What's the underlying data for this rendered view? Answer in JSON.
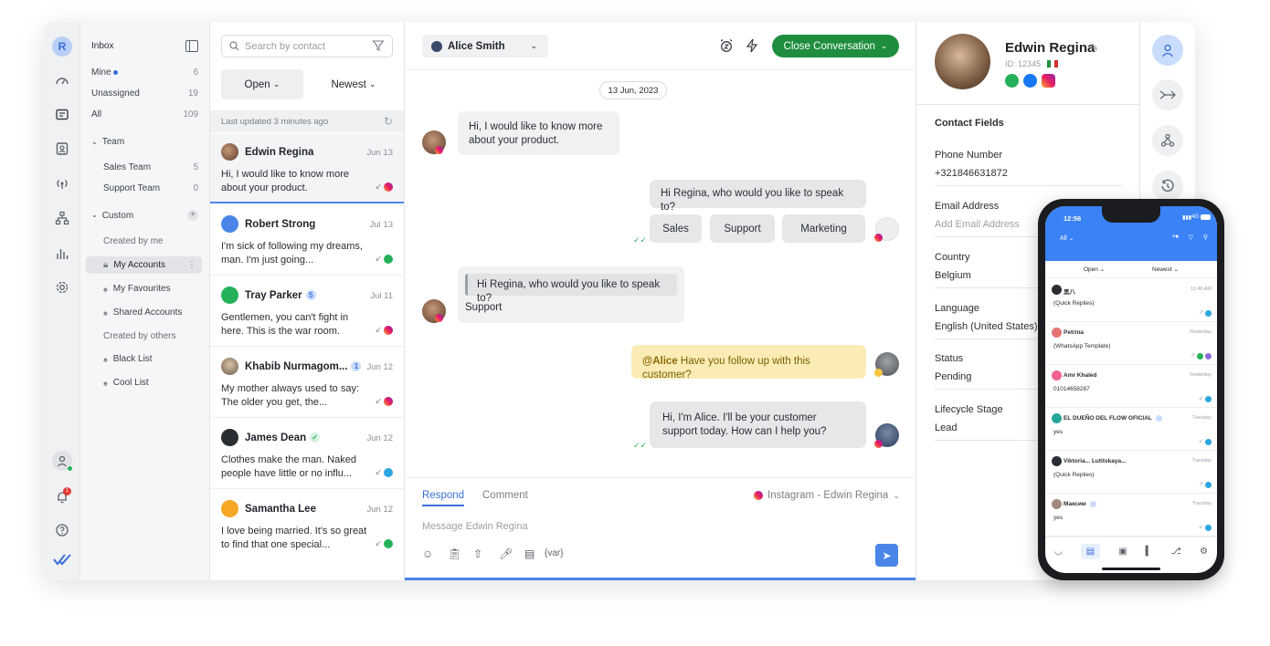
{
  "rail": {
    "avatar_letter": "R",
    "icons": [
      "dashboard-icon",
      "messages-icon",
      "contacts-icon",
      "broadcast-icon",
      "workflows-icon",
      "reports-icon",
      "settings-icon"
    ],
    "bottom_icons": [
      "user-status-icon",
      "notifications-icon",
      "help-icon",
      "logo-icon"
    ],
    "notification_count": "1"
  },
  "inbox": {
    "title": "Inbox",
    "items": [
      {
        "label": "Mine",
        "count": "6"
      },
      {
        "label": "Unassigned",
        "count": "19"
      },
      {
        "label": "All",
        "count": "109"
      }
    ],
    "team_header": "Team",
    "teams": [
      {
        "label": "Sales Team",
        "count": "5"
      },
      {
        "label": "Support Team",
        "count": "0"
      }
    ],
    "custom_header": "Custom",
    "created_by_me": "Created by me",
    "my_lists": [
      "My Accounts",
      "My Favourites",
      "Shared Accounts"
    ],
    "created_by_others": "Created by others",
    "other_lists": [
      "Black List",
      "Cool List"
    ]
  },
  "conversations": {
    "search_placeholder": "Search by contact",
    "status_filter": "Open",
    "sort": "Newest",
    "last_updated": "Last updated 3 minutes ago",
    "items": [
      {
        "name": "Edwin Regina",
        "date": "Jun 13",
        "message": "Hi, I would like to know more about your product.",
        "channel": "instagram",
        "badge": ""
      },
      {
        "name": "Robert Strong",
        "date": "Jul 13",
        "message": "I'm sick of following my dreams, man. I'm just going...",
        "channel": "whatsapp",
        "badge": ""
      },
      {
        "name": "Tray Parker",
        "date": "Jul 11",
        "message": "Gentlemen, you can't fight in here. This is the war room.",
        "channel": "instagram",
        "badge": "5"
      },
      {
        "name": "Khabib Nurmagom...",
        "date": "Jun 12",
        "message": "My mother always used to say: The older you get, the...",
        "channel": "instagram",
        "badge": "1"
      },
      {
        "name": "James Dean",
        "date": "Jun 12",
        "message": "Clothes make the man. Naked people have little or no influ...",
        "channel": "telegram",
        "badge": ""
      },
      {
        "name": "Samantha Lee",
        "date": "Jun 12",
        "message": "I love being married. It's so great to find that one special...",
        "channel": "whatsapp",
        "badge": ""
      }
    ]
  },
  "chat": {
    "contact": "Alice Smith",
    "close_label": "Close Conversation",
    "date": "13 Jun, 2023",
    "msg1": "Hi, I would like to know more about your product.",
    "msg2": "Hi Regina, who would you like to speak to?",
    "quick_replies": [
      "Sales",
      "Support",
      "Marketing"
    ],
    "quote": "Hi Regina, who would you like to speak to?",
    "reply": "Support",
    "note_mention": "@Alice",
    "note_text": " Have you follow up with this customer?",
    "msg3": "Hi, I'm Alice. I'll be your customer support today. How can I help you?",
    "tab_respond": "Respond",
    "tab_comment": "Comment",
    "channel_select": "Instagram - Edwin Regina",
    "composer_placeholder": "Message Edwin Regina",
    "var_label": "{var}"
  },
  "contact": {
    "name": "Edwin Regina",
    "id": "ID: 12345",
    "fields_title": "Contact Fields",
    "fields": [
      {
        "label": "Phone Number",
        "value": "+321846631872"
      },
      {
        "label": "Email Address",
        "value": "Add Email Address"
      },
      {
        "label": "Country",
        "value": "Belgium"
      },
      {
        "label": "Language",
        "value": "English (United States)"
      },
      {
        "label": "Status",
        "value": "Pending"
      },
      {
        "label": "Lifecycle Stage",
        "value": "Lead"
      }
    ]
  },
  "phone": {
    "time": "12:56",
    "signal": "4G",
    "filter": "All",
    "status": "Open",
    "sort": "Newest",
    "items": [
      {
        "name": "黑八",
        "date": "11:46 AM",
        "message": "(Quick Replies)"
      },
      {
        "name": "Petrina",
        "date": "Yesterday",
        "message": "(WhatsApp Template)"
      },
      {
        "name": "Amr Khaled",
        "date": "Yesterday",
        "message": "01014658287"
      },
      {
        "name": "EL DUEÑO DEL FLOW OFICIAL",
        "date": "Tuesday",
        "message": "yes"
      },
      {
        "name": "Viktoria... Lutitskaya...",
        "date": "Tuesday",
        "message": "(Quick Replies)"
      },
      {
        "name": "Максим",
        "date": "Tuesday",
        "message": "yes"
      }
    ]
  },
  "colors": {
    "accent": "#4a86e8",
    "close_button": "#1e8e3e",
    "note": "#fbecb6",
    "phone_header": "#3b82f6"
  }
}
